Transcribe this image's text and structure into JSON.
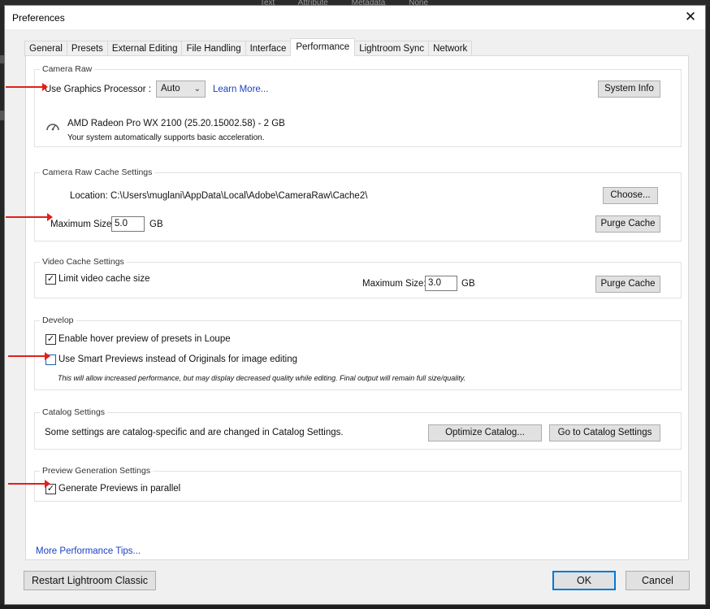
{
  "background": {
    "toolbar_items": [
      "Text",
      "Attribute",
      "Metadata",
      "None"
    ]
  },
  "window": {
    "title": "Preferences",
    "close_glyph": "✕"
  },
  "tabs": [
    {
      "label": "General",
      "active": false
    },
    {
      "label": "Presets",
      "active": false
    },
    {
      "label": "External Editing",
      "active": false
    },
    {
      "label": "File Handling",
      "active": false
    },
    {
      "label": "Interface",
      "active": false
    },
    {
      "label": "Performance",
      "active": true
    },
    {
      "label": "Lightroom Sync",
      "active": false
    },
    {
      "label": "Network",
      "active": false
    }
  ],
  "camera_raw": {
    "legend": "Camera Raw",
    "gpu_label": "Use Graphics Processor :",
    "gpu_value": "Auto",
    "learn_more": "Learn More...",
    "system_info": "System Info",
    "gpu_name": "AMD Radeon Pro WX 2100 (25.20.15002.58) - 2 GB",
    "gpu_status": "Your system automatically supports basic acceleration.",
    "gauge_icon": "gauge-icon"
  },
  "cache": {
    "legend": "Camera Raw Cache Settings",
    "location_label": "Location:",
    "location_value": "C:\\Users\\muglani\\AppData\\Local\\Adobe\\CameraRaw\\Cache2\\",
    "choose": "Choose...",
    "max_label": "Maximum Size:",
    "max_value": "5.0",
    "unit": "GB",
    "purge": "Purge Cache"
  },
  "video_cache": {
    "legend": "Video Cache Settings",
    "limit_label": "Limit video cache size",
    "limit_checked": true,
    "max_label": "Maximum Size:",
    "max_value": "3.0",
    "unit": "GB",
    "purge": "Purge Cache"
  },
  "develop": {
    "legend": "Develop",
    "hover_label": "Enable hover preview of presets in Loupe",
    "hover_checked": true,
    "smart_label": "Use Smart Previews instead of Originals for image editing",
    "smart_checked": false,
    "note": "This will allow increased performance, but may display decreased quality while editing. Final output will remain full size/quality."
  },
  "catalog": {
    "legend": "Catalog Settings",
    "text": "Some settings are catalog-specific and are changed in Catalog Settings.",
    "optimize": "Optimize Catalog...",
    "goto": "Go to Catalog Settings"
  },
  "preview": {
    "legend": "Preview Generation Settings",
    "parallel_label": "Generate Previews in parallel",
    "parallel_checked": true
  },
  "more_tips": "More Performance Tips...",
  "footer": {
    "restart": "Restart Lightroom Classic",
    "ok": "OK",
    "cancel": "Cancel"
  },
  "colors": {
    "annotation_arrow": "#e0201b",
    "link": "#1a3fc4",
    "primary_border": "#0078d7"
  }
}
